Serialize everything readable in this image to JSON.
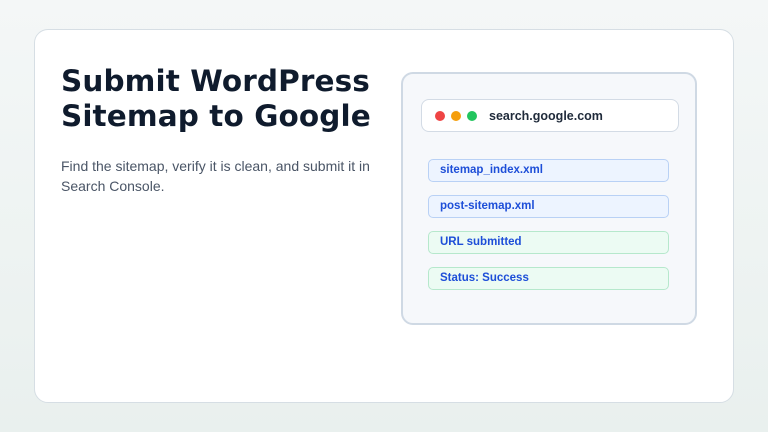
{
  "slide": {
    "title_line1": "Submit WordPress",
    "title_line2": "Sitemap to Google",
    "description": "Find the sitemap, verify it is clean, and submit it in Search Console."
  },
  "browser": {
    "url": "search.google.com",
    "window_dots": [
      "red",
      "amber",
      "green"
    ]
  },
  "items": [
    {
      "label": "sitemap_index.xml",
      "style": "blue"
    },
    {
      "label": "post-sitemap.xml",
      "style": "blue"
    },
    {
      "label": "URL submitted",
      "style": "green"
    },
    {
      "label": "Status: Success",
      "style": "green"
    }
  ],
  "colors": {
    "title": "#0f1b2d",
    "row_text": "#1d4ed8",
    "dot_red": "#ef4444",
    "dot_amber": "#f59e0b",
    "dot_green": "#22c55e"
  }
}
